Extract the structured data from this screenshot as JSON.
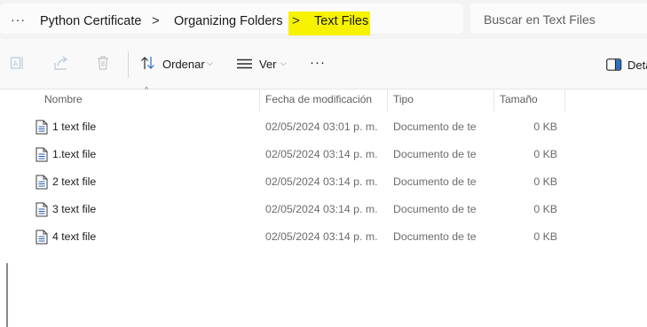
{
  "breadcrumb": {
    "overflow_label": "···",
    "items": [
      "Python Certificate",
      "Organizing Folders",
      "Text Files"
    ],
    "separator": ">"
  },
  "search": {
    "placeholder": "Buscar en Text Files"
  },
  "toolbar": {
    "sort_label": "Ordenar",
    "view_label": "Ver",
    "more_label": "···",
    "details_label": "Deta"
  },
  "columns": {
    "name": "Nombre",
    "date": "Fecha de modificación",
    "type": "Tipo",
    "size": "Tamaño"
  },
  "files": [
    {
      "name": "1 text file",
      "date": "02/05/2024 03:01 p. m.",
      "type": "Documento de te",
      "size": "0 KB"
    },
    {
      "name": "1.text file",
      "date": "02/05/2024 03:14 p. m.",
      "type": "Documento de te",
      "size": "0 KB"
    },
    {
      "name": "2 text file",
      "date": "02/05/2024 03:14 p. m.",
      "type": "Documento de te",
      "size": "0 KB"
    },
    {
      "name": "3 text file",
      "date": "02/05/2024 03:14 p. m.",
      "type": "Documento de te",
      "size": "0 KB"
    },
    {
      "name": "4 text file",
      "date": "02/05/2024 03:14 p. m.",
      "type": "Documento de te",
      "size": "0 KB"
    }
  ],
  "colors": {
    "highlight": "#f6f200",
    "icon_blue": "#1e5aa8"
  }
}
